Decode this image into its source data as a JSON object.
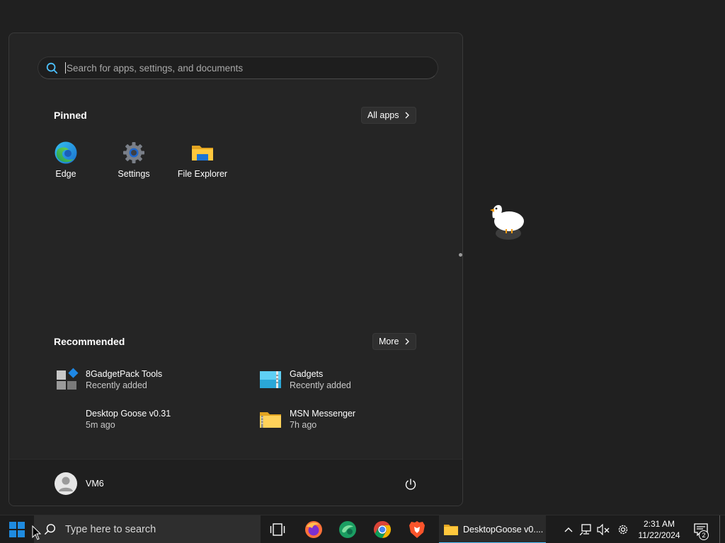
{
  "start_menu": {
    "search": {
      "placeholder": "Search for apps, settings, and documents"
    },
    "pinned": {
      "title": "Pinned",
      "all_apps_label": "All apps",
      "apps": [
        {
          "label": "Edge",
          "icon": "edge-icon"
        },
        {
          "label": "Settings",
          "icon": "settings-gear-icon"
        },
        {
          "label": "File Explorer",
          "icon": "folder-icon"
        }
      ]
    },
    "recommended": {
      "title": "Recommended",
      "more_label": "More",
      "items": [
        {
          "name": "8GadgetPack Tools",
          "sub": "Recently added",
          "icon": "gadgetpack-icon"
        },
        {
          "name": "Gadgets",
          "sub": "Recently added",
          "icon": "gadgets-icon"
        },
        {
          "name": "Desktop Goose v0.31",
          "sub": "5m ago",
          "icon": ""
        },
        {
          "name": "MSN Messenger",
          "sub": "7h ago",
          "icon": "zip-folder-icon"
        }
      ]
    },
    "user": {
      "name": "VM6"
    }
  },
  "taskbar": {
    "search_placeholder": "Type here to search",
    "pinned_apps": [
      "task-view-icon",
      "firefox-icon",
      "msn-messenger-icon",
      "chrome-icon",
      "brave-icon"
    ],
    "active_window": {
      "label": "DesktopGoose v0....",
      "icon": "folder-icon"
    },
    "clock": {
      "time": "2:31 AM",
      "date": "11/22/2024"
    },
    "notifications_count": "2"
  },
  "colors": {
    "accent": "#4cc2ff",
    "start_menu_bg": "#252525",
    "desktop_bg": "#202020",
    "taskbar_bg": "#1c1c1c"
  }
}
